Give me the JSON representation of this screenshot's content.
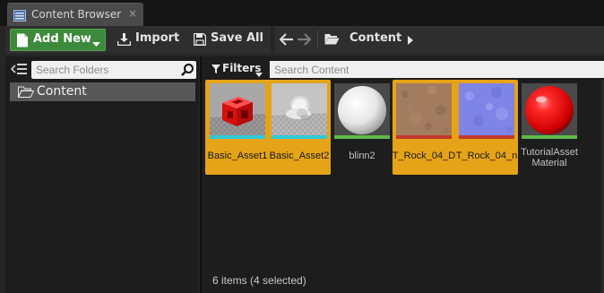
{
  "tab": {
    "title": "Content Browser",
    "close": "×",
    "icon": "content-browser-icon"
  },
  "toolbar": {
    "add_new": "Add New",
    "import": "Import",
    "save_all": "Save All",
    "add_new_color": "#3c8a3a"
  },
  "path": {
    "crumbs": [
      "Content"
    ]
  },
  "folders": {
    "search_placeholder": "Search Folders",
    "items": [
      {
        "label": "Content",
        "selected": true
      }
    ]
  },
  "content": {
    "filters_label": "Filters",
    "search_placeholder": "Search Content",
    "selection_color": "#e5a317",
    "assets": [
      {
        "label": "Basic_Asset1",
        "selected": true,
        "type_color": "#2ec9d8",
        "icon": "red-cube-thumbnail"
      },
      {
        "label": "Basic_Asset2",
        "selected": true,
        "type_color": "#2ec9d8",
        "icon": "white-mesh-thumbnail"
      },
      {
        "label": "blinn2",
        "selected": false,
        "type_color": "#5cb84a",
        "icon": "white-sphere-thumbnail"
      },
      {
        "label": "T_Rock_04_D",
        "selected": true,
        "type_color": "#c0392b",
        "icon": "rock-texture-thumbnail"
      },
      {
        "label": "T_Rock_04_n",
        "selected": true,
        "type_color": "#c0392b",
        "icon": "normal-map-thumbnail"
      },
      {
        "label": "TutorialAsset Material",
        "selected": false,
        "type_color": "#5cb84a",
        "icon": "red-sphere-thumbnail"
      }
    ],
    "status": "6 items (4 selected)"
  }
}
